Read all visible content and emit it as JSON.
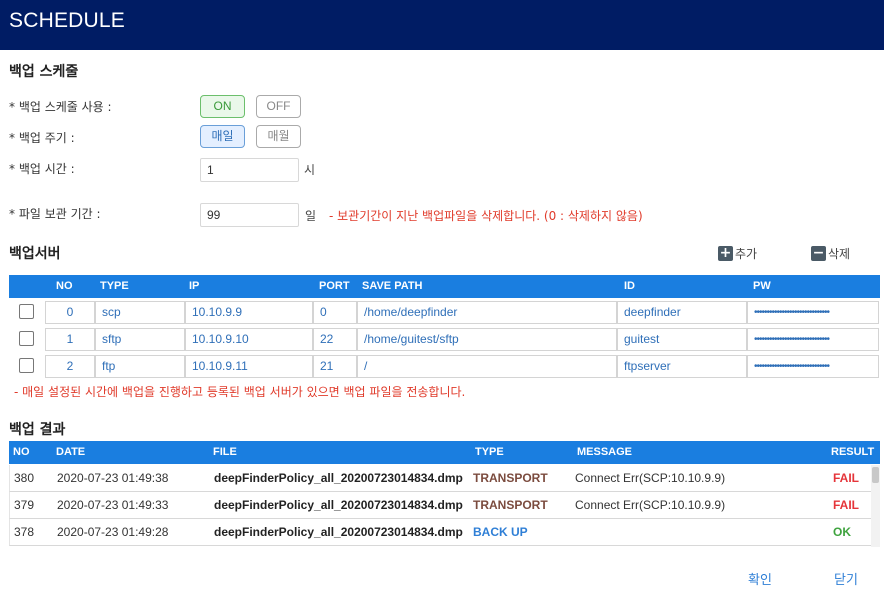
{
  "window": {
    "title": "SCHEDULE"
  },
  "backup_schedule": {
    "section_title": "백업 스케줄",
    "use_label": "* 백업 스케줄 사용 :",
    "on_label": "ON",
    "off_label": "OFF",
    "use_selected": "ON",
    "cycle_label": "* 백업 주기 :",
    "daily_label": "매일",
    "monthly_label": "매월",
    "cycle_selected": "매일",
    "time_label": "* 백업 시간 :",
    "time_value": "1",
    "time_unit": "시",
    "retention_label": "* 파일 보관 기간 :",
    "retention_value": "99",
    "retention_unit": "일",
    "retention_note": "- 보관기간이 지난 백업파일을 삭제합니다. (0 : 삭제하지 않음)"
  },
  "backup_server": {
    "section_title": "백업서버",
    "add_label": "추가",
    "delete_label": "삭제",
    "columns": {
      "no": "NO",
      "type": "TYPE",
      "ip": "IP",
      "port": "PORT",
      "path": "SAVE PATH",
      "id": "ID",
      "pw": "PW"
    },
    "rows": [
      {
        "no": "0",
        "type": "scp",
        "ip": "10.10.9.9",
        "port": "0",
        "path": "/home/deepfinder",
        "id": "deepfinder",
        "pw": "••••••••••••••••••••••••••••••"
      },
      {
        "no": "1",
        "type": "sftp",
        "ip": "10.10.9.10",
        "port": "22",
        "path": "/home/guitest/sftp",
        "id": "guitest",
        "pw": "••••••••••••••••••••••••••••••"
      },
      {
        "no": "2",
        "type": "ftp",
        "ip": "10.10.9.11",
        "port": "21",
        "path": "/",
        "id": "ftpserver",
        "pw": "••••••••••••••••••••••••••••••"
      }
    ],
    "note": "- 매일 설정된 시간에 백업을 진행하고 등록된 백업 서버가 있으면 백업 파일을 전송합니다."
  },
  "backup_result": {
    "section_title": "백업 결과",
    "columns": {
      "no": "NO",
      "date": "DATE",
      "file": "FILE",
      "type": "TYPE",
      "message": "MESSAGE",
      "result": "RESULT"
    },
    "rows": [
      {
        "no": "380",
        "date": "2020-07-23 01:49:38",
        "file": "deepFinderPolicy_all_20200723014834.dmp",
        "type": "TRANSPORT",
        "message": "Connect Err(SCP:10.10.9.9)",
        "result": "FAIL"
      },
      {
        "no": "379",
        "date": "2020-07-23 01:49:33",
        "file": "deepFinderPolicy_all_20200723014834.dmp",
        "type": "TRANSPORT",
        "message": "Connect Err(SCP:10.10.9.9)",
        "result": "FAIL"
      },
      {
        "no": "378",
        "date": "2020-07-23 01:49:28",
        "file": "deepFinderPolicy_all_20200723014834.dmp",
        "type": "BACK UP",
        "message": "",
        "result": "OK"
      }
    ]
  },
  "footer": {
    "confirm_label": "확인",
    "close_label": "닫기"
  }
}
